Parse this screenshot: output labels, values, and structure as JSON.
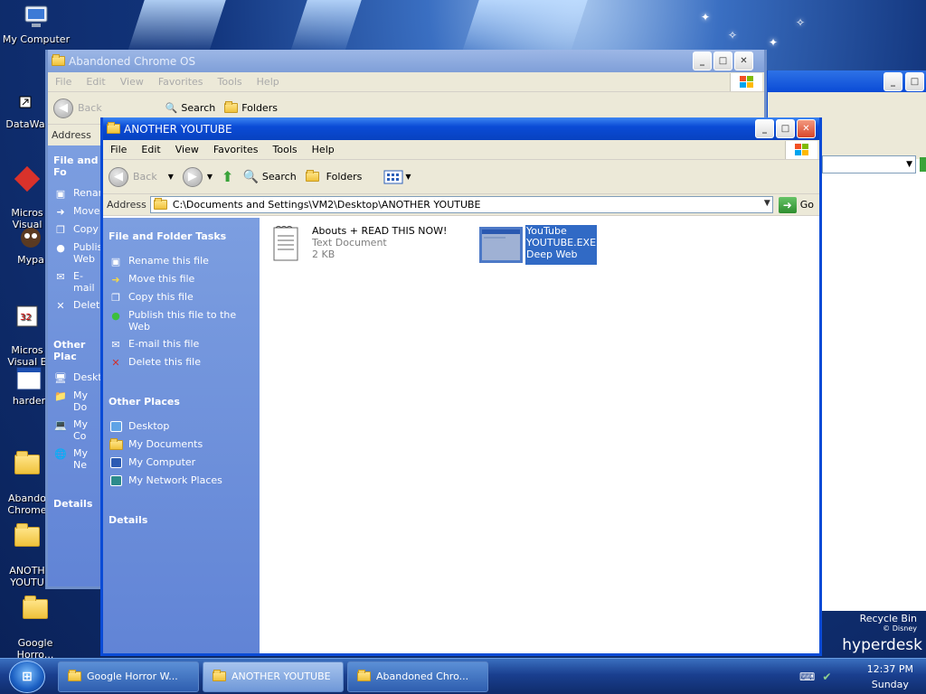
{
  "desktop": {
    "icons": [
      {
        "label": "My Computer",
        "icon": "computer-icon"
      },
      {
        "label": "DataWa",
        "icon": "shortcut-icon"
      },
      {
        "label": "Micros\nVisual",
        "icon": "shortcut-icon"
      },
      {
        "label": "Mypa",
        "icon": "shortcut-icon"
      },
      {
        "label": "Micros\nVisual E",
        "icon": "shortcut-icon"
      },
      {
        "label": "harder",
        "icon": "window-icon"
      },
      {
        "label": "Abando\nChrome",
        "icon": "folder-icon"
      },
      {
        "label": "ANOTH\nYOUTU",
        "icon": "folder-icon"
      },
      {
        "label": "Google\nHorro...",
        "icon": "folder-icon"
      }
    ],
    "recycle_bin": {
      "label": "Recycle Bin",
      "sub": "© Disney"
    },
    "brand": "hyperdesk"
  },
  "back_window": {
    "title": "Abandoned Chrome OS",
    "menu": [
      "File",
      "Edit",
      "View",
      "Favorites",
      "Tools",
      "Help"
    ],
    "toolbar": {
      "back": "Back",
      "search": "Search",
      "folders": "Folders"
    },
    "address_label": "Address",
    "side_heading_1": "File and Fo",
    "side_items_1": [
      "Renan",
      "Move",
      "Copy",
      "Publis\nWeb",
      "E-mail",
      "Delete"
    ],
    "side_heading_2": "Other Plac",
    "side_items_2": [
      "Deskt",
      "My Do",
      "My Co",
      "My Ne"
    ],
    "side_heading_3": "Details"
  },
  "main_window": {
    "title": "ANOTHER YOUTUBE",
    "menu": [
      "File",
      "Edit",
      "View",
      "Favorites",
      "Tools",
      "Help"
    ],
    "toolbar": {
      "back": "Back",
      "search": "Search",
      "folders": "Folders"
    },
    "address": {
      "label": "Address",
      "path": "C:\\Documents and Settings\\VM2\\Desktop\\ANOTHER YOUTUBE",
      "go": "Go"
    },
    "tasks": {
      "heading": "File and Folder Tasks",
      "items": [
        {
          "label": "Rename this file",
          "icon": "rename-icon"
        },
        {
          "label": "Move this file",
          "icon": "move-icon"
        },
        {
          "label": "Copy this file",
          "icon": "copy-icon"
        },
        {
          "label": "Publish this file to the Web",
          "icon": "publish-icon"
        },
        {
          "label": "E-mail this file",
          "icon": "email-icon"
        },
        {
          "label": "Delete this file",
          "icon": "delete-icon"
        }
      ]
    },
    "other_places": {
      "heading": "Other Places",
      "items": [
        {
          "label": "Desktop",
          "icon": "desktop-icon"
        },
        {
          "label": "My Documents",
          "icon": "my-documents-icon"
        },
        {
          "label": "My Computer",
          "icon": "computer-icon"
        },
        {
          "label": "My Network Places",
          "icon": "network-icon"
        }
      ]
    },
    "details_heading": "Details",
    "files": [
      {
        "name": "Abouts + READ THIS NOW!",
        "type": "Text Document",
        "size": "2 KB",
        "icon": "text-document-icon"
      },
      {
        "name": "YouTube",
        "type": "YOUTUBE.EXE",
        "size": "Deep Web",
        "icon": "exe-window-icon",
        "selected": true
      }
    ]
  },
  "taskbar": {
    "start": "start-orb",
    "tasks": [
      {
        "label": "Google Horror W...",
        "active": false
      },
      {
        "label": "ANOTHER YOUTUBE",
        "active": true
      },
      {
        "label": "Abandoned Chro...",
        "active": false
      }
    ],
    "time": "12:37 PM",
    "day": "Sunday"
  },
  "colors": {
    "titlebar": "#0a4bd6",
    "sidepane": "#6f91dc",
    "selection": "#316ac5"
  }
}
